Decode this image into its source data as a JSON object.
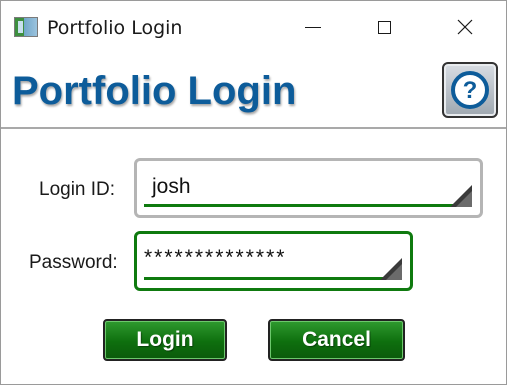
{
  "window": {
    "title": "Portfolio Login",
    "controls": {
      "minimize_icon": "minimize-icon",
      "maximize_icon": "maximize-icon",
      "close_icon": "close-icon"
    }
  },
  "header": {
    "title": "Portfolio Login",
    "help_icon": "question-mark-icon"
  },
  "form": {
    "login_label": "Login ID:",
    "login_value": "josh",
    "password_label": "Password:",
    "password_value": "**************"
  },
  "buttons": {
    "login_label": "Login",
    "cancel_label": "Cancel"
  },
  "colors": {
    "brand_blue": "#0d5c9a",
    "accent_green": "#0f7a0f",
    "button_green": "#0e6f0e"
  }
}
